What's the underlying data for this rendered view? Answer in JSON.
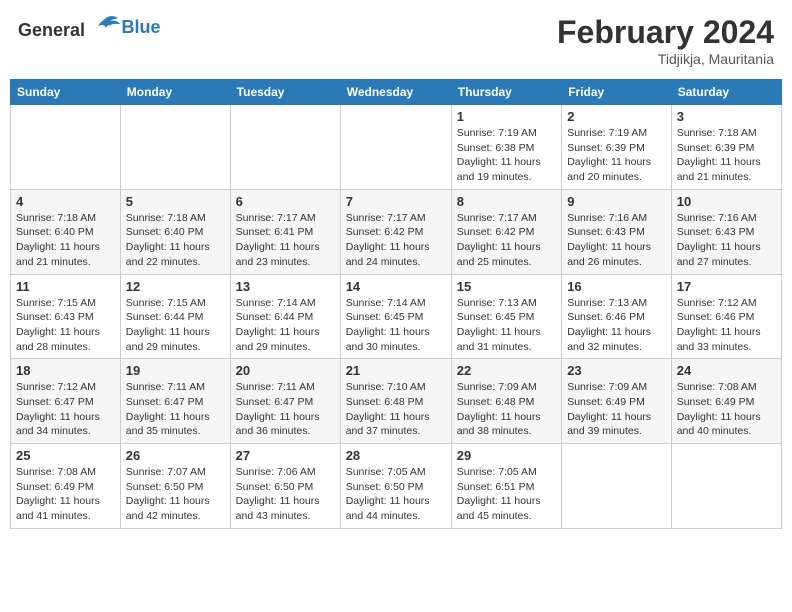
{
  "header": {
    "logo_general": "General",
    "logo_blue": "Blue",
    "month_year": "February 2024",
    "location": "Tidjikja, Mauritania"
  },
  "weekdays": [
    "Sunday",
    "Monday",
    "Tuesday",
    "Wednesday",
    "Thursday",
    "Friday",
    "Saturday"
  ],
  "weeks": [
    [
      {
        "day": "",
        "info": ""
      },
      {
        "day": "",
        "info": ""
      },
      {
        "day": "",
        "info": ""
      },
      {
        "day": "",
        "info": ""
      },
      {
        "day": "1",
        "info": "Sunrise: 7:19 AM\nSunset: 6:38 PM\nDaylight: 11 hours\nand 19 minutes."
      },
      {
        "day": "2",
        "info": "Sunrise: 7:19 AM\nSunset: 6:39 PM\nDaylight: 11 hours\nand 20 minutes."
      },
      {
        "day": "3",
        "info": "Sunrise: 7:18 AM\nSunset: 6:39 PM\nDaylight: 11 hours\nand 21 minutes."
      }
    ],
    [
      {
        "day": "4",
        "info": "Sunrise: 7:18 AM\nSunset: 6:40 PM\nDaylight: 11 hours\nand 21 minutes."
      },
      {
        "day": "5",
        "info": "Sunrise: 7:18 AM\nSunset: 6:40 PM\nDaylight: 11 hours\nand 22 minutes."
      },
      {
        "day": "6",
        "info": "Sunrise: 7:17 AM\nSunset: 6:41 PM\nDaylight: 11 hours\nand 23 minutes."
      },
      {
        "day": "7",
        "info": "Sunrise: 7:17 AM\nSunset: 6:42 PM\nDaylight: 11 hours\nand 24 minutes."
      },
      {
        "day": "8",
        "info": "Sunrise: 7:17 AM\nSunset: 6:42 PM\nDaylight: 11 hours\nand 25 minutes."
      },
      {
        "day": "9",
        "info": "Sunrise: 7:16 AM\nSunset: 6:43 PM\nDaylight: 11 hours\nand 26 minutes."
      },
      {
        "day": "10",
        "info": "Sunrise: 7:16 AM\nSunset: 6:43 PM\nDaylight: 11 hours\nand 27 minutes."
      }
    ],
    [
      {
        "day": "11",
        "info": "Sunrise: 7:15 AM\nSunset: 6:43 PM\nDaylight: 11 hours\nand 28 minutes."
      },
      {
        "day": "12",
        "info": "Sunrise: 7:15 AM\nSunset: 6:44 PM\nDaylight: 11 hours\nand 29 minutes."
      },
      {
        "day": "13",
        "info": "Sunrise: 7:14 AM\nSunset: 6:44 PM\nDaylight: 11 hours\nand 29 minutes."
      },
      {
        "day": "14",
        "info": "Sunrise: 7:14 AM\nSunset: 6:45 PM\nDaylight: 11 hours\nand 30 minutes."
      },
      {
        "day": "15",
        "info": "Sunrise: 7:13 AM\nSunset: 6:45 PM\nDaylight: 11 hours\nand 31 minutes."
      },
      {
        "day": "16",
        "info": "Sunrise: 7:13 AM\nSunset: 6:46 PM\nDaylight: 11 hours\nand 32 minutes."
      },
      {
        "day": "17",
        "info": "Sunrise: 7:12 AM\nSunset: 6:46 PM\nDaylight: 11 hours\nand 33 minutes."
      }
    ],
    [
      {
        "day": "18",
        "info": "Sunrise: 7:12 AM\nSunset: 6:47 PM\nDaylight: 11 hours\nand 34 minutes."
      },
      {
        "day": "19",
        "info": "Sunrise: 7:11 AM\nSunset: 6:47 PM\nDaylight: 11 hours\nand 35 minutes."
      },
      {
        "day": "20",
        "info": "Sunrise: 7:11 AM\nSunset: 6:47 PM\nDaylight: 11 hours\nand 36 minutes."
      },
      {
        "day": "21",
        "info": "Sunrise: 7:10 AM\nSunset: 6:48 PM\nDaylight: 11 hours\nand 37 minutes."
      },
      {
        "day": "22",
        "info": "Sunrise: 7:09 AM\nSunset: 6:48 PM\nDaylight: 11 hours\nand 38 minutes."
      },
      {
        "day": "23",
        "info": "Sunrise: 7:09 AM\nSunset: 6:49 PM\nDaylight: 11 hours\nand 39 minutes."
      },
      {
        "day": "24",
        "info": "Sunrise: 7:08 AM\nSunset: 6:49 PM\nDaylight: 11 hours\nand 40 minutes."
      }
    ],
    [
      {
        "day": "25",
        "info": "Sunrise: 7:08 AM\nSunset: 6:49 PM\nDaylight: 11 hours\nand 41 minutes."
      },
      {
        "day": "26",
        "info": "Sunrise: 7:07 AM\nSunset: 6:50 PM\nDaylight: 11 hours\nand 42 minutes."
      },
      {
        "day": "27",
        "info": "Sunrise: 7:06 AM\nSunset: 6:50 PM\nDaylight: 11 hours\nand 43 minutes."
      },
      {
        "day": "28",
        "info": "Sunrise: 7:05 AM\nSunset: 6:50 PM\nDaylight: 11 hours\nand 44 minutes."
      },
      {
        "day": "29",
        "info": "Sunrise: 7:05 AM\nSunset: 6:51 PM\nDaylight: 11 hours\nand 45 minutes."
      },
      {
        "day": "",
        "info": ""
      },
      {
        "day": "",
        "info": ""
      }
    ]
  ]
}
